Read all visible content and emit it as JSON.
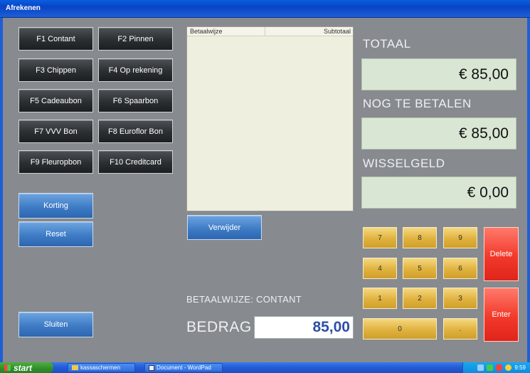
{
  "window": {
    "title": "Afrekenen"
  },
  "payment_buttons": [
    {
      "key": "f1",
      "label": "F1 Contant"
    },
    {
      "key": "f2",
      "label": "F2 Pinnen"
    },
    {
      "key": "f3",
      "label": "F3 Chippen"
    },
    {
      "key": "f4",
      "label": "F4 Op rekening"
    },
    {
      "key": "f5",
      "label": "F5 Cadeaubon"
    },
    {
      "key": "f6",
      "label": "F6 Spaarbon"
    },
    {
      "key": "f7",
      "label": "F7 VVV Bon"
    },
    {
      "key": "f8",
      "label": "F8 Euroflor Bon"
    },
    {
      "key": "f9",
      "label": "F9 Fleuropbon"
    },
    {
      "key": "f10",
      "label": "F10 Creditcard"
    }
  ],
  "actions": {
    "korting": "Korting",
    "reset": "Reset",
    "sluiten": "Sluiten",
    "verwijder": "Verwijder"
  },
  "payment_list": {
    "columns": {
      "method": "Betaalwijze",
      "subtotal": "Subtotaal"
    },
    "rows": []
  },
  "totals": {
    "totaal_label": "TOTAAL",
    "totaal_value": "€ 85,00",
    "nog_label": "NOG TE BETALEN",
    "nog_value": "€ 85,00",
    "wissel_label": "WISSELGELD",
    "wissel_value": "€ 0,00"
  },
  "status": {
    "betaalwijze": "BETAALWIJZE: CONTANT"
  },
  "bedrag": {
    "label": "BEDRAG",
    "value": "85,00"
  },
  "numpad": {
    "k7": "7",
    "k8": "8",
    "k9": "9",
    "k4": "4",
    "k5": "5",
    "k6": "6",
    "k1": "1",
    "k2": "2",
    "k3": "3",
    "k0": "0",
    "dot": ".",
    "delete": "Delete",
    "enter": "Enter"
  },
  "taskbar": {
    "start": "start",
    "items": [
      "kassaschermen",
      "Document - WordPad"
    ],
    "clock": "9:59"
  }
}
